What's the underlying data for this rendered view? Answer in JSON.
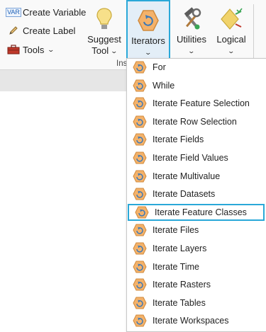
{
  "ribbon": {
    "create_variable": "Create Variable",
    "create_variable_icon_text": "VAR",
    "create_label": "Create Label",
    "tools": "Tools",
    "suggest_tool_line1": "Suggest",
    "suggest_tool_line2": "Tool",
    "iterators": "Iterators",
    "utilities": "Utilities",
    "logical": "Logical",
    "group_label": "Ins"
  },
  "menu": {
    "items": [
      {
        "label": "For"
      },
      {
        "label": "While"
      },
      {
        "label": "Iterate Feature Selection"
      },
      {
        "label": "Iterate Row Selection"
      },
      {
        "label": "Iterate Fields"
      },
      {
        "label": "Iterate Field Values"
      },
      {
        "label": "Iterate Multivalue"
      },
      {
        "label": "Iterate Datasets"
      },
      {
        "label": "Iterate Feature Classes",
        "selected": true
      },
      {
        "label": "Iterate Files"
      },
      {
        "label": "Iterate Layers"
      },
      {
        "label": "Iterate Time"
      },
      {
        "label": "Iterate Rasters"
      },
      {
        "label": "Iterate Tables"
      },
      {
        "label": "Iterate Workspaces"
      }
    ]
  },
  "colors": {
    "highlight": "#2aa8d8",
    "iterator_fill": "#f4b26a",
    "iterator_stroke": "#d08a3c",
    "logical_fill": "#f1d36b"
  },
  "icons": {
    "create_variable": "var-icon",
    "create_label": "pencil-icon",
    "tools": "toolbox-icon",
    "suggest_tool": "lightbulb-icon",
    "iterators": "iterator-hexagon-icon",
    "utilities": "hammer-wrench-icon",
    "logical": "diamond-check-icon",
    "menu_item": "iterator-hexagon-icon"
  }
}
